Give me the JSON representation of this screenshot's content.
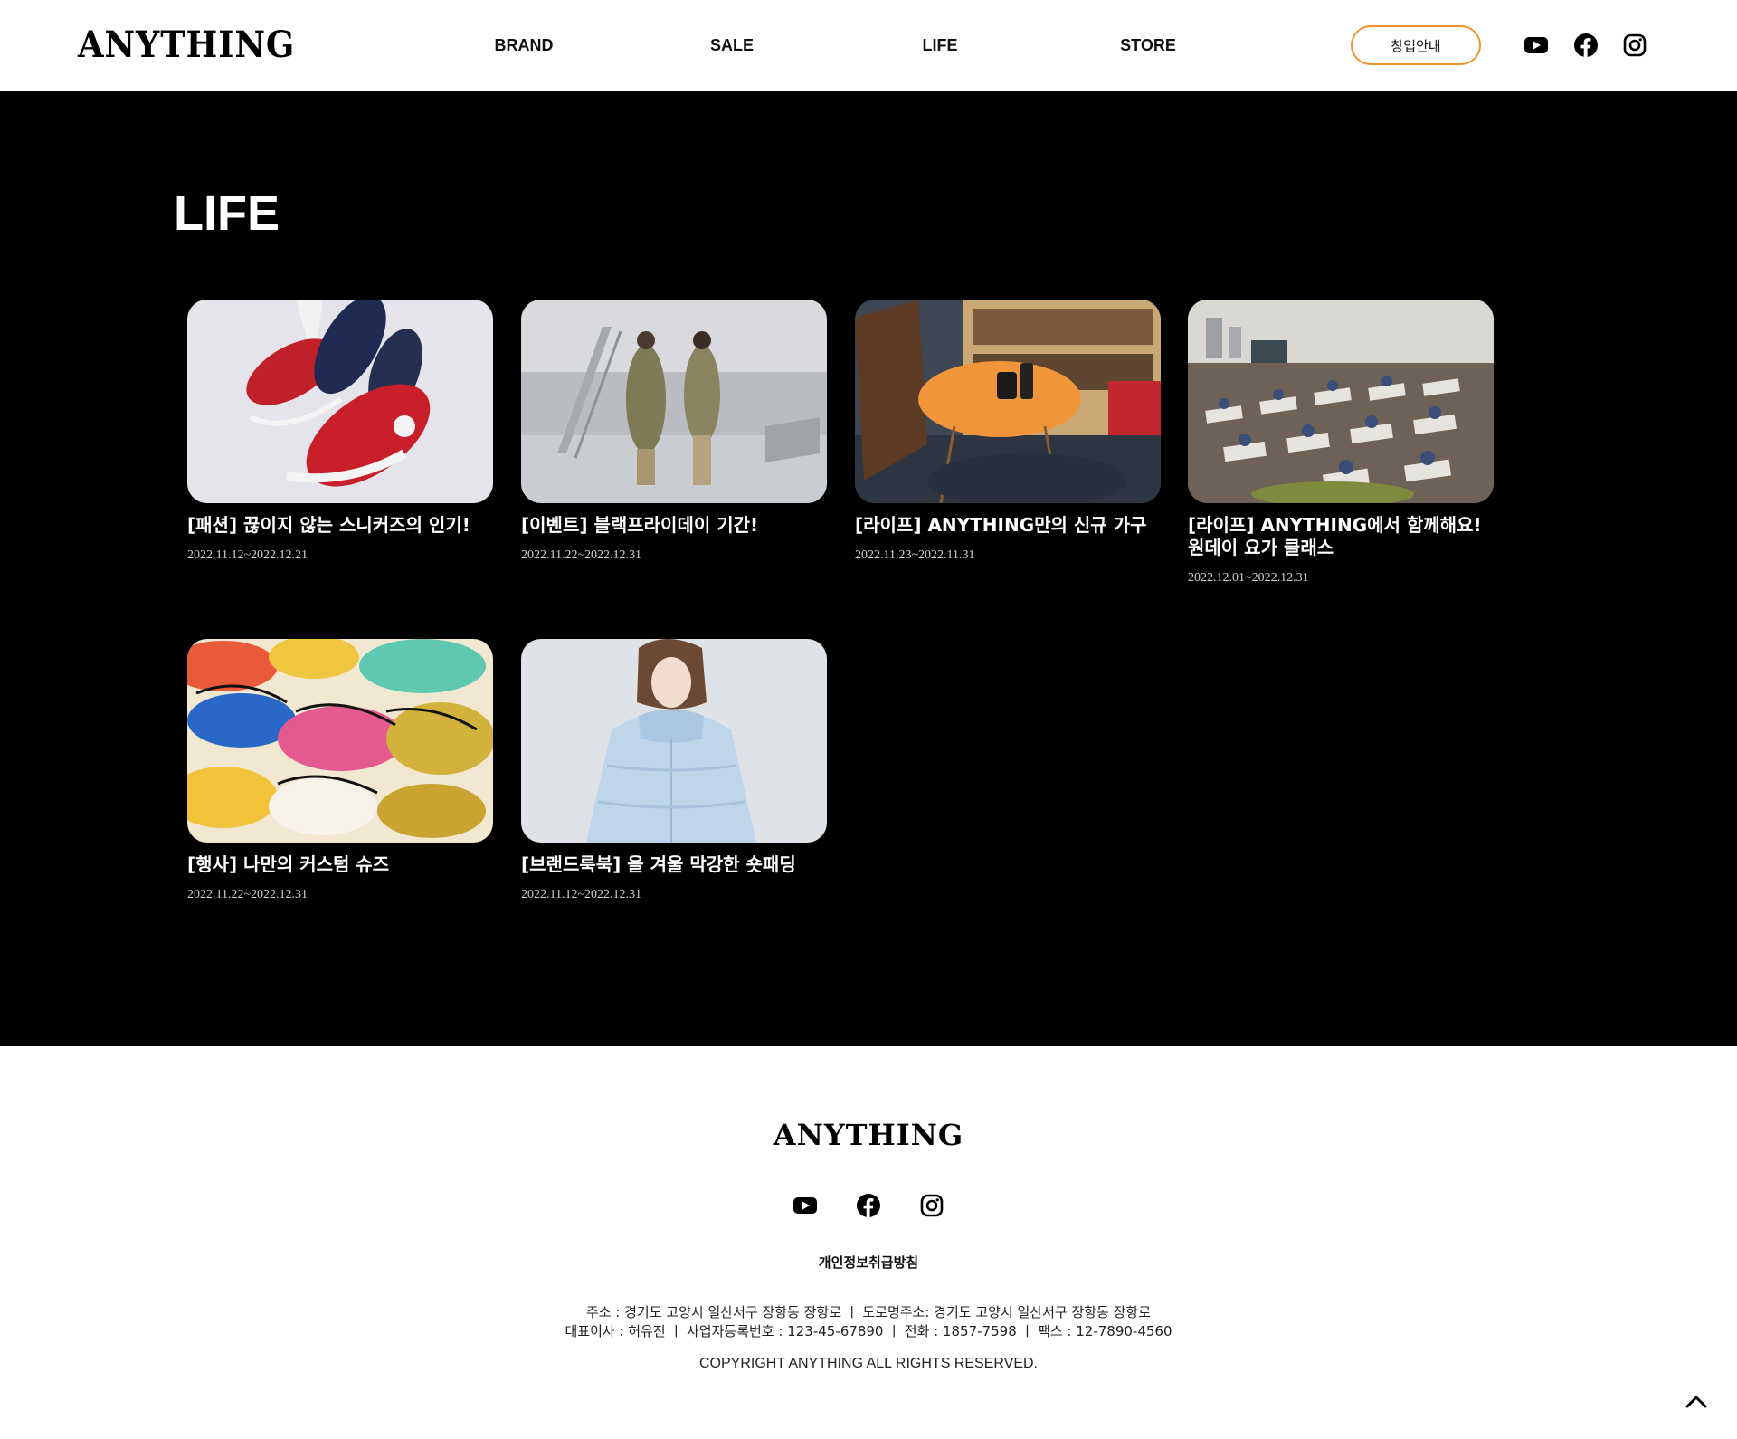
{
  "header": {
    "logo": "ANYTHING",
    "nav": [
      "BRAND",
      "SALE",
      "LIFE",
      "STORE"
    ],
    "startup_button": "창업안내",
    "social_icons": [
      "youtube-icon",
      "facebook-icon",
      "instagram-icon"
    ]
  },
  "main": {
    "title": "LIFE",
    "cards": [
      {
        "title": "[패션] 끊이지 않는 스니커즈의 인기!",
        "date": "2022.11.12~2022.12.21"
      },
      {
        "title": "[이벤트] 블랙프라이데이 기간!",
        "date": "2022.11.22~2022.12.31"
      },
      {
        "title": "[라이프] ANYTHING만의 신규 가구",
        "date": "2022.11.23~2022.11.31"
      },
      {
        "title": "[라이프] ANYTHING에서 함께해요!\n원데이 요가 클래스",
        "date": "2022.12.01~2022.12.31"
      },
      {
        "title": "[행사] 나만의 커스텀 슈즈",
        "date": "2022.11.22~2022.12.31"
      },
      {
        "title": "[브랜드룩북] 올 겨울 막강한 숏패딩",
        "date": "2022.11.12~2022.12.31"
      }
    ]
  },
  "footer": {
    "logo": "ANYTHING",
    "privacy": "개인정보취급방침",
    "address_line1": "주소 : 경기도 고양시 일산서구 장항동 장항로 ㅣ 도로명주소: 경기도 고양시 일산서구 장항동 장항로",
    "address_line2": "대표이사 : 허유진 ㅣ 사업자등록번호 : 123-45-67890 ㅣ 전화 : 1857-7598 ㅣ 팩스 : 12-7890-4560",
    "copyright": "COPYRIGHT ANYTHING ALL RIGHTS RESERVED."
  },
  "colors": {
    "accent": "#f0952b",
    "main_bg": "#000000",
    "text_light": "#ffffff"
  }
}
